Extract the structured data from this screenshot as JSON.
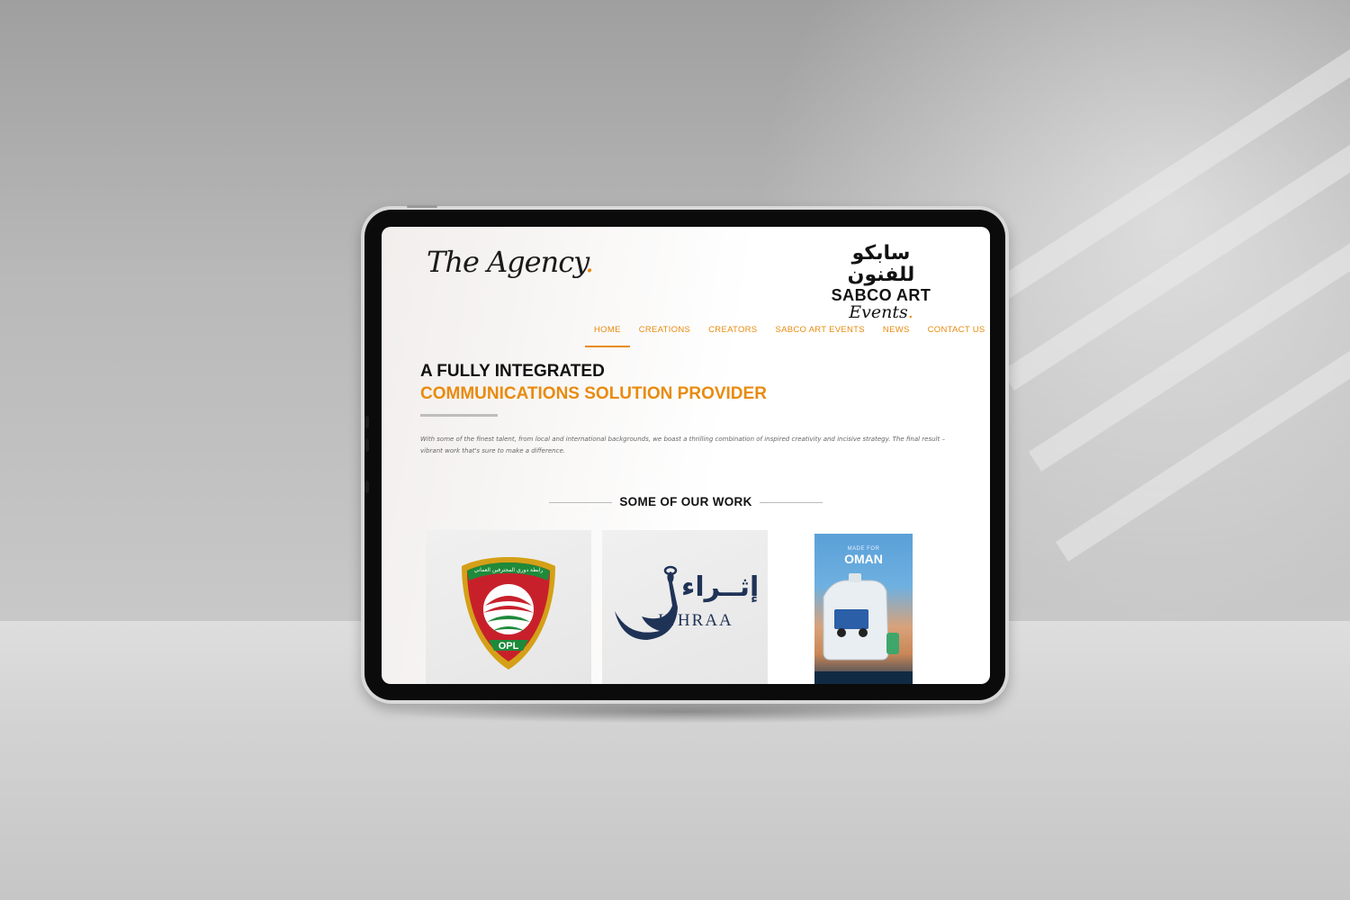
{
  "header": {
    "agency_logo": "The Agency",
    "sabco_logo": {
      "arabic": "سابكو للفنون",
      "english": "SABCO ART",
      "script": "Events"
    }
  },
  "nav": {
    "items": [
      {
        "label": "HOME",
        "active": true
      },
      {
        "label": "CREATIONS",
        "active": false
      },
      {
        "label": "CREATORS",
        "active": false
      },
      {
        "label": "SABCO ART EVENTS",
        "active": false
      },
      {
        "label": "NEWS",
        "active": false
      },
      {
        "label": "CONTACT US",
        "active": false
      }
    ]
  },
  "hero": {
    "heading_line1": "A FULLY INTEGRATED",
    "heading_line2": "COMMUNICATIONS SOLUTION PROVIDER",
    "intro": "With some of the finest talent, from local and international backgrounds, we boast a thrilling combination of inspired creativity and incisive strategy. The final result – vibrant work that's sure to make a difference."
  },
  "work": {
    "section_title": "SOME OF OUR WORK",
    "items": [
      {
        "name": "opl-logo",
        "badge_text": "OPL",
        "arabic": "رابطة دوري المحترفين العماني"
      },
      {
        "name": "ithraa-logo",
        "arabic": "إثــراء",
        "english": "ITHRAA"
      },
      {
        "name": "oman-poster",
        "made_for": "MADE FOR",
        "title": "OMAN"
      }
    ]
  },
  "colors": {
    "accent": "#e98b0f",
    "heading": "#111111",
    "ithraa_blue": "#1f3357",
    "opl_red": "#c8202b",
    "opl_green": "#1e8a3a",
    "opl_gold": "#d4a017"
  }
}
